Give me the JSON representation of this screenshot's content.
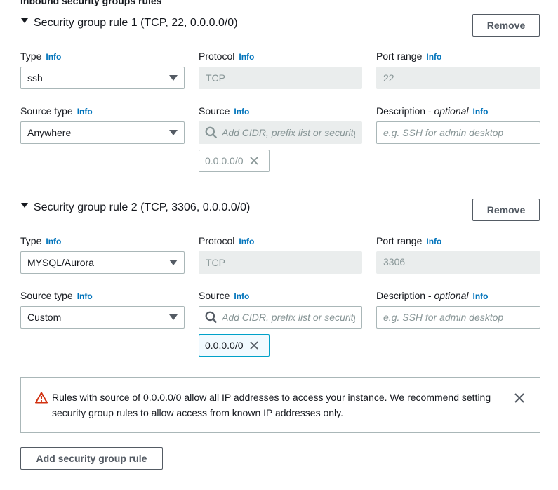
{
  "section": {
    "title": "Inbound security groups rules"
  },
  "rules": [
    {
      "title": "Security group rule 1 (TCP, 22, 0.0.0.0/0)",
      "remove_label": "Remove",
      "type_label": "Type",
      "type_value": "ssh",
      "protocol_label": "Protocol",
      "protocol_value": "TCP",
      "port_label": "Port range",
      "port_value": "22",
      "source_type_label": "Source type",
      "source_type_value": "Anywhere",
      "source_label": "Source",
      "source_placeholder": "Add CIDR, prefix list or security",
      "source_token": "0.0.0.0/0",
      "description_label": "Description - ",
      "description_optional": "optional",
      "description_placeholder": "e.g. SSH for admin desktop"
    },
    {
      "title": "Security group rule 2 (TCP, 3306, 0.0.0.0/0)",
      "remove_label": "Remove",
      "type_label": "Type",
      "type_value": "MYSQL/Aurora",
      "protocol_label": "Protocol",
      "protocol_value": "TCP",
      "port_label": "Port range",
      "port_value": "3306",
      "source_type_label": "Source type",
      "source_type_value": "Custom",
      "source_label": "Source",
      "source_placeholder": "Add CIDR, prefix list or security",
      "source_token": "0.0.0.0/0",
      "description_label": "Description - ",
      "description_optional": "optional",
      "description_placeholder": "e.g. SSH for admin desktop"
    }
  ],
  "info_label": "Info",
  "alert": {
    "message": "Rules with source of 0.0.0.0/0 allow all IP addresses to access your instance. We recommend setting security group rules to allow access from known IP addresses only."
  },
  "add_rule_label": "Add security group rule",
  "icons": {
    "warning": "warning-icon",
    "close": "close-icon",
    "search": "search-icon",
    "caret": "caret-down-icon"
  },
  "colors": {
    "link": "#0073bb",
    "warning": "#d13212",
    "focus": "#00a1c9",
    "disabled_bg": "#eaeded"
  }
}
